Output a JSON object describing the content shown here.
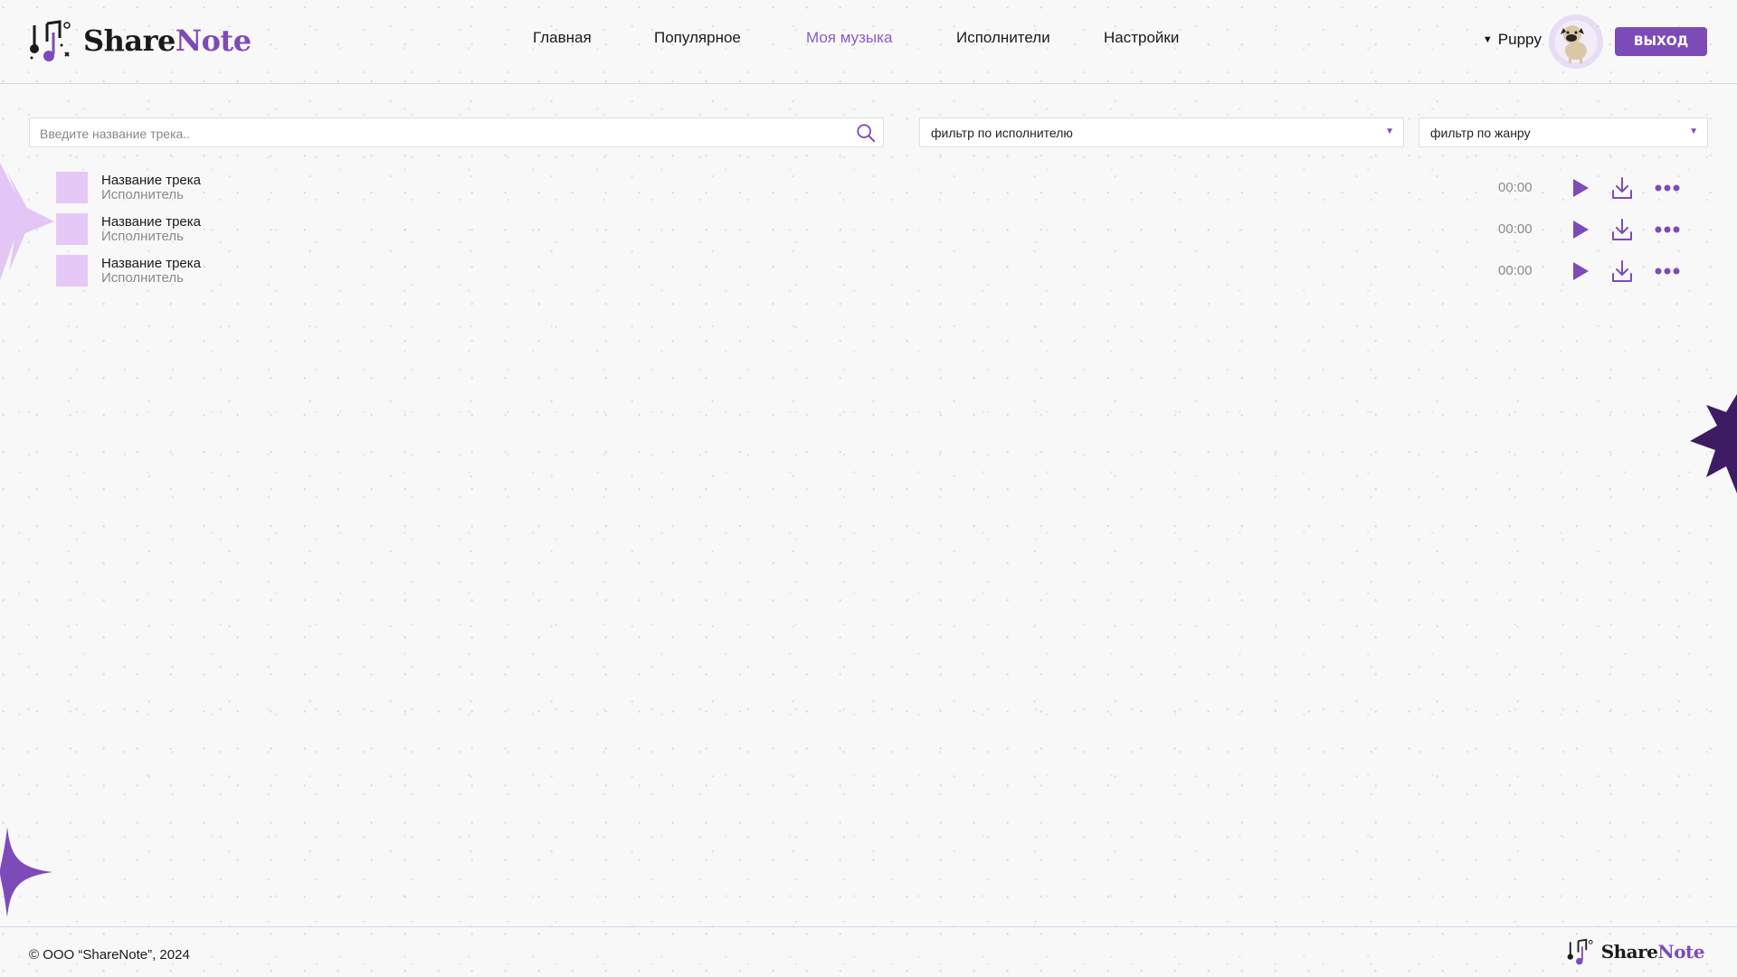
{
  "brand": {
    "name_part1": "Share",
    "name_part2": "Note"
  },
  "nav": {
    "items": [
      {
        "label": "Главная",
        "active": false
      },
      {
        "label": "Популярное",
        "active": false
      },
      {
        "label": "Моя музыка",
        "active": true
      },
      {
        "label": "Исполнители",
        "active": false
      },
      {
        "label": "Настройки",
        "active": false
      }
    ]
  },
  "user": {
    "name": "Puppy",
    "caret": "▼",
    "avatar_icon": "pug-avatar-icon"
  },
  "logout_label": "ВЫХОД",
  "search": {
    "placeholder": "Введите название трека..",
    "value": "",
    "icon": "search-icon"
  },
  "filters": {
    "artist": {
      "value": "фильтр по исполнителю",
      "caret": "▼"
    },
    "genre": {
      "value": "фильтр по жанру",
      "caret": "▼"
    }
  },
  "tracks": [
    {
      "title": "Название трека",
      "artist": "Исполнитель",
      "duration": "00:00"
    },
    {
      "title": "Название трека",
      "artist": "Исполнитель",
      "duration": "00:00"
    },
    {
      "title": "Название трека",
      "artist": "Исполнитель",
      "duration": "00:00"
    }
  ],
  "footer": {
    "copyright": "© ООО “ShareNote”, 2024"
  },
  "colors": {
    "accent": "#7d4bb8",
    "accent_light": "#8a5cc6",
    "cover": "#e6c8f6",
    "deco_dark": "#3d1c63",
    "deco_light": "#e3c6f5"
  }
}
